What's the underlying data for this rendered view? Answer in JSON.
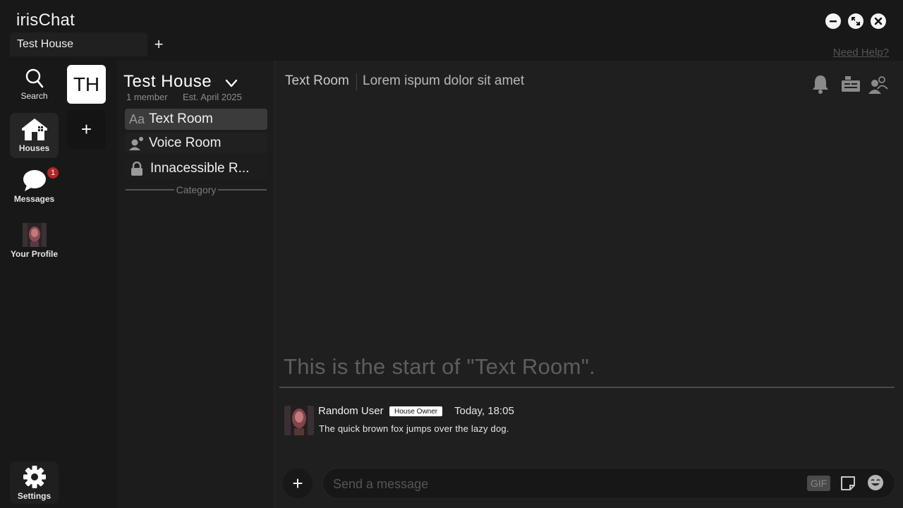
{
  "app": {
    "title": "irisChat",
    "need_help": "Need Help?"
  },
  "tabs": [
    {
      "label": "Test House"
    }
  ],
  "tab_add_label": "+",
  "rail": {
    "search_label": "Search",
    "houses_label": "Houses",
    "messages_label": "Messages",
    "messages_badge": "1",
    "profile_label": "Your Profile",
    "settings_label": "Settings"
  },
  "houses": {
    "current_initials": "TH",
    "add_label": "+"
  },
  "house": {
    "name": "Test House",
    "members": "1 member",
    "established": "Est. April 2025",
    "rooms": [
      {
        "name": "Text Room",
        "icon": "text-room-icon",
        "glyph": "Aa",
        "selected": true
      },
      {
        "name": "Voice Room",
        "icon": "voice-room-icon"
      },
      {
        "name": "Innacessible R...",
        "icon": "lock-icon"
      }
    ],
    "category": "Category"
  },
  "room": {
    "title": "Text Room",
    "topic": "Lorem ispum dolor sit amet",
    "start_text": "This is the start of \"Text Room\"."
  },
  "messages": [
    {
      "author": "Random User",
      "role": "House Owner",
      "time": "Today, 18:05",
      "body": "The quick brown fox jumps over the lazy dog."
    }
  ],
  "composer": {
    "add_label": "+",
    "placeholder": "Send a message",
    "gif_label": "GIF"
  },
  "colors": {
    "background": "#181818",
    "panel": "#1c1c1c",
    "main": "#1f1f1f",
    "badge": "#b42525",
    "selected_room": "#3b3b3b"
  }
}
